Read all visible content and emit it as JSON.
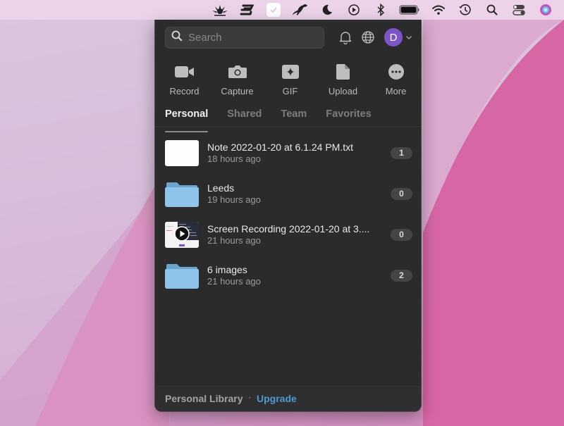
{
  "colors": {
    "accent": "#4a9ad8",
    "avatar_bg": "#7b55c9",
    "folder": "#8ec4ea",
    "panel_bg": "#2b2b2b"
  },
  "menubar": {
    "icons": [
      "peacock-app-icon",
      "expressvpn-icon",
      "checkbox-app-icon",
      "kangaroo-app-icon",
      "moon-icon",
      "play-circle-icon",
      "bluetooth-icon",
      "battery-icon",
      "wifi-icon",
      "time-machine-icon",
      "spotlight-search-icon",
      "control-center-icon",
      "siri-icon"
    ]
  },
  "panel": {
    "search": {
      "placeholder": "Search",
      "value": ""
    },
    "avatar": {
      "initial": "D"
    },
    "actions": [
      {
        "label": "Record",
        "icon": "video-camera-icon"
      },
      {
        "label": "Capture",
        "icon": "camera-icon"
      },
      {
        "label": "GIF",
        "icon": "gif-sparkle-icon"
      },
      {
        "label": "Upload",
        "icon": "document-icon"
      },
      {
        "label": "More",
        "icon": "more-dots-icon"
      }
    ],
    "tabs": [
      {
        "label": "Personal",
        "active": true
      },
      {
        "label": "Shared",
        "active": false
      },
      {
        "label": "Team",
        "active": false
      },
      {
        "label": "Favorites",
        "active": false
      }
    ],
    "items": [
      {
        "name": "Note 2022-01-20 at 6.1.24 PM.txt",
        "time": "18 hours ago",
        "count": "1",
        "type": "file"
      },
      {
        "name": "Leeds",
        "time": "19 hours ago",
        "count": "0",
        "type": "folder"
      },
      {
        "name": "Screen Recording 2022-01-20 at 3....",
        "time": "21 hours ago",
        "count": "0",
        "type": "video"
      },
      {
        "name": "6 images",
        "time": "21 hours ago",
        "count": "2",
        "type": "folder"
      }
    ],
    "footer": {
      "library": "Personal Library",
      "separator": "•",
      "upgrade": "Upgrade"
    }
  }
}
